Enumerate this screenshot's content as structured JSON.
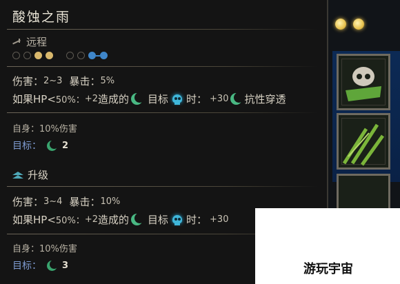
{
  "skill": {
    "name": "酸蚀之雨",
    "range_label": "远程",
    "positions": {
      "launch": [
        "empty",
        "empty",
        "gold",
        "gold"
      ],
      "target": [
        "empty",
        "empty",
        "blue",
        "blue"
      ]
    },
    "base": {
      "damage_label": "伤害：",
      "damage_value": "2~3",
      "crit_label": "暴击：",
      "crit_value": "5%",
      "cond_prefix": "如果HP<",
      "cond_pct": "50%：",
      "cond_bonus": "+2",
      "cond_dealt": "造成的",
      "cond_target": "目标",
      "cond_when": "时：",
      "cond_pen": "+30",
      "cond_resist": "抗性穿透",
      "self_label": "自身：",
      "self_value": "10%伤害",
      "target_label": "目标：",
      "target_value": "2"
    },
    "upgrade_label": "升级",
    "upgraded": {
      "damage_label": "伤害：",
      "damage_value": "3~4",
      "crit_label": "暴击：",
      "crit_value": "10%",
      "cond_prefix": "如果HP<",
      "cond_pct": "50%：",
      "cond_bonus": "+2",
      "cond_dealt": "造成的",
      "cond_target": "目标",
      "cond_when": "时：",
      "cond_pen": "+30",
      "self_label": "自身：",
      "self_value": "10%伤害",
      "target_label": "目标：",
      "target_value": "3"
    }
  },
  "watermark": "游玩宇宙",
  "colors": {
    "launch_pip": "#d9b86c",
    "target_pip": "#3f86c9",
    "blight": "#3aa46e",
    "skull": "#3fb6d9"
  }
}
